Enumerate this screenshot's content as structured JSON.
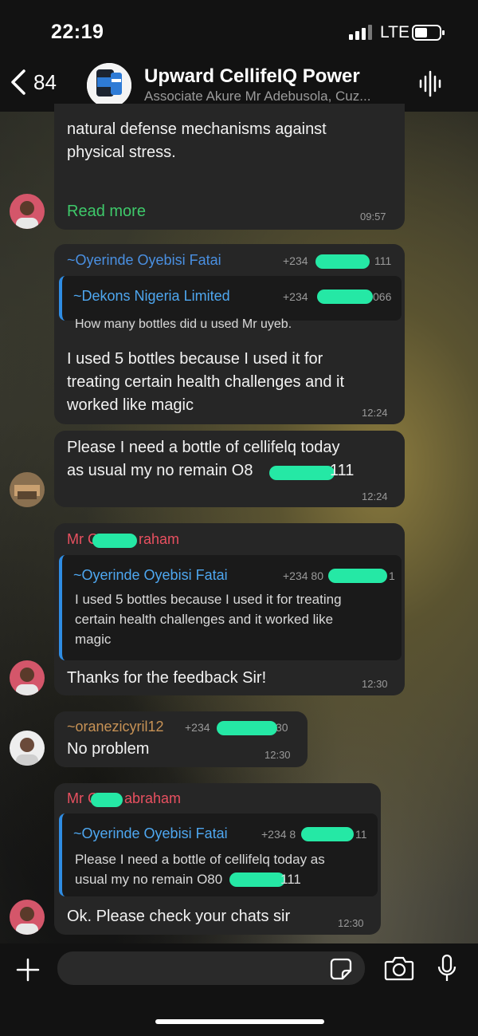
{
  "status_bar": {
    "time": "22:19",
    "network": "LTE"
  },
  "header": {
    "back_count": "84",
    "title": "Upward CellifeIQ Power",
    "subtitle": "Associate Akure Mr Adebusola, Cuz..."
  },
  "messages": [
    {
      "text_line_a": "natural defense mechanisms against",
      "text_line_b": "physical stress.",
      "read_more": "Read more",
      "time": "09:57"
    },
    {
      "sender": "~Oyerinde Oyebisi Fatai",
      "phone_prefix": "+234",
      "phone_suffix": "111",
      "quote_sender": "~Dekons Nigeria Limited",
      "quote_phone_prefix": "+234",
      "quote_phone_suffix": "066",
      "quote_text": "How many bottles did u used Mr uyeb.",
      "text_line_a": "I used 5 bottles because I used it for",
      "text_line_b": "treating certain health challenges and it",
      "text_line_c": "worked like magic",
      "time": "12:24"
    },
    {
      "text_line_a": "Please I need a bottle of cellifelq today",
      "text_line_b_start": "as usual my no remain O8",
      "text_line_b_end": "111",
      "time": "12:24"
    },
    {
      "sender_start": "Mr C",
      "sender_end": "raham",
      "quote_sender": "~Oyerinde Oyebisi Fatai",
      "quote_phone_prefix": "+234 80",
      "quote_phone_suffix": "1",
      "quote_line_a": "I used 5 bottles because I used it for treating",
      "quote_line_b": "certain health challenges and it worked like",
      "quote_line_c": "magic",
      "text": "Thanks for the feedback Sir!",
      "time": "12:30"
    },
    {
      "sender": "~oranezicyril12",
      "phone_prefix": "+234",
      "phone_suffix": "30",
      "text": "No problem",
      "time": "12:30"
    },
    {
      "sender_start": "Mr C",
      "sender_end": "abraham",
      "quote_sender": "~Oyerinde Oyebisi Fatai",
      "quote_phone_prefix": "+234 8",
      "quote_phone_suffix": "11",
      "quote_line_a": "Please I need a bottle of cellifelq today as",
      "quote_line_b_start": "usual my no remain O80",
      "quote_line_b_end": "111",
      "text": "Ok. Please check your chats sir",
      "time": "12:30"
    }
  ],
  "colors": {
    "read_more": "#3ec96a",
    "sender_oyerinde": "#4a90e2",
    "sender_abraham": "#e85060",
    "sender_oranezi": "#c79255",
    "quote_bar": "#2f8de4",
    "redaction": "#25e8a5"
  },
  "icons": [
    "chevron-left-icon",
    "signal-icon",
    "battery-icon",
    "voice-wave-icon",
    "plus-icon",
    "sticker-icon",
    "camera-icon",
    "mic-icon"
  ]
}
